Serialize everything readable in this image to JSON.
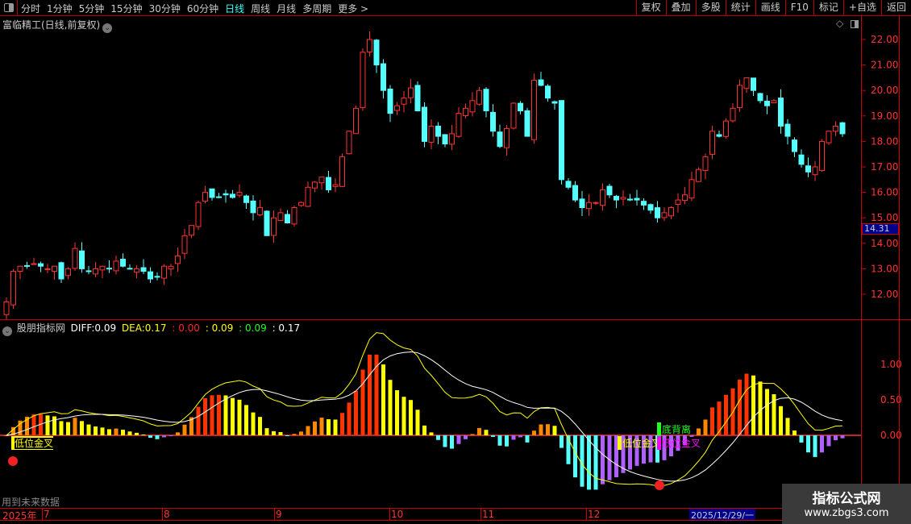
{
  "toolbar": {
    "periods": [
      "分时",
      "1分钟",
      "5分钟",
      "15分钟",
      "30分钟",
      "60分钟",
      "日线",
      "周线",
      "月线",
      "多周期",
      "更多 >"
    ],
    "active": "日线",
    "buttons": [
      "复权",
      "叠加",
      "多股",
      "统计",
      "画线",
      "F10",
      "标记",
      "+自选",
      "返回"
    ]
  },
  "main": {
    "title": "富临精工(日线,前复权)",
    "price_ticks": [
      "22.00",
      "21.00",
      "20.00",
      "19.00",
      "18.00",
      "17.00",
      "16.00",
      "15.00",
      "14.00",
      "13.00",
      "12.00"
    ],
    "current_price": "14.31"
  },
  "indicator": {
    "name": "股朋指标网",
    "diff_label": "DIFF:",
    "diff": "0.09",
    "dea_label": "DEA:",
    "dea": "0.17",
    "v1": ": 0.00",
    "v2": ": 0.09",
    "v3": ": 0.09",
    "v4": ": 0.17",
    "ticks": [
      "1.00",
      "0.50",
      "0.00"
    ],
    "signals": {
      "low_cross": "低位金叉",
      "bottom_div": "底背离"
    },
    "future_note": "用到未来数据"
  },
  "time_axis": {
    "year": "2025年",
    "months": [
      "7",
      "8",
      "9",
      "10",
      "11",
      "12"
    ],
    "cursor_date": "2025/12/29/一"
  },
  "watermark": {
    "title": "指标公式网",
    "url": "www.zbgs3.com"
  },
  "colors": {
    "up": "#ff3232",
    "down": "#54ffff",
    "accent": "#c00000"
  },
  "chart_data": {
    "type": "candlestick",
    "ylim": [
      11.5,
      22.5
    ],
    "closes": [
      11.7,
      12.9,
      13.1,
      13.1,
      13.2,
      13.1,
      13.0,
      13.1,
      12.6,
      13.0,
      13.8,
      13.0,
      12.9,
      13.0,
      13.1,
      13.0,
      13.3,
      13.1,
      13.0,
      13.0,
      12.9,
      12.6,
      12.7,
      13.1,
      13.1,
      13.5,
      14.3,
      14.7,
      15.6,
      16.0,
      15.8,
      15.8,
      15.9,
      15.8,
      16.0,
      15.6,
      15.2,
      15.4,
      14.3,
      15.0,
      15.2,
      14.8,
      15.4,
      15.6,
      16.2,
      16.4,
      16.6,
      16.1,
      16.3,
      17.4,
      18.4,
      19.3,
      21.5,
      22.0,
      21.0,
      20.0,
      19.1,
      19.4,
      19.7,
      20.1,
      19.2,
      18.0,
      18.6,
      18.2,
      17.9,
      18.3,
      19.1,
      19.3,
      19.6,
      20.0,
      19.2,
      18.4,
      17.8,
      18.5,
      19.5,
      19.2,
      18.2,
      20.4,
      20.2,
      19.7,
      19.5,
      16.5,
      16.2,
      15.7,
      15.4,
      15.6,
      15.6,
      16.1,
      15.9,
      15.7,
      15.8,
      15.7,
      15.7,
      15.5,
      15.3,
      15.0,
      15.2,
      15.4,
      15.7,
      15.9,
      16.5,
      16.9,
      17.4,
      18.4,
      18.2,
      18.8,
      19.3,
      20.2,
      20.5,
      20.0,
      19.6,
      19.4,
      19.6,
      18.6,
      18.2,
      17.6,
      17.1,
      16.8,
      17.0,
      18.0,
      18.4,
      18.6,
      18.3
    ]
  }
}
